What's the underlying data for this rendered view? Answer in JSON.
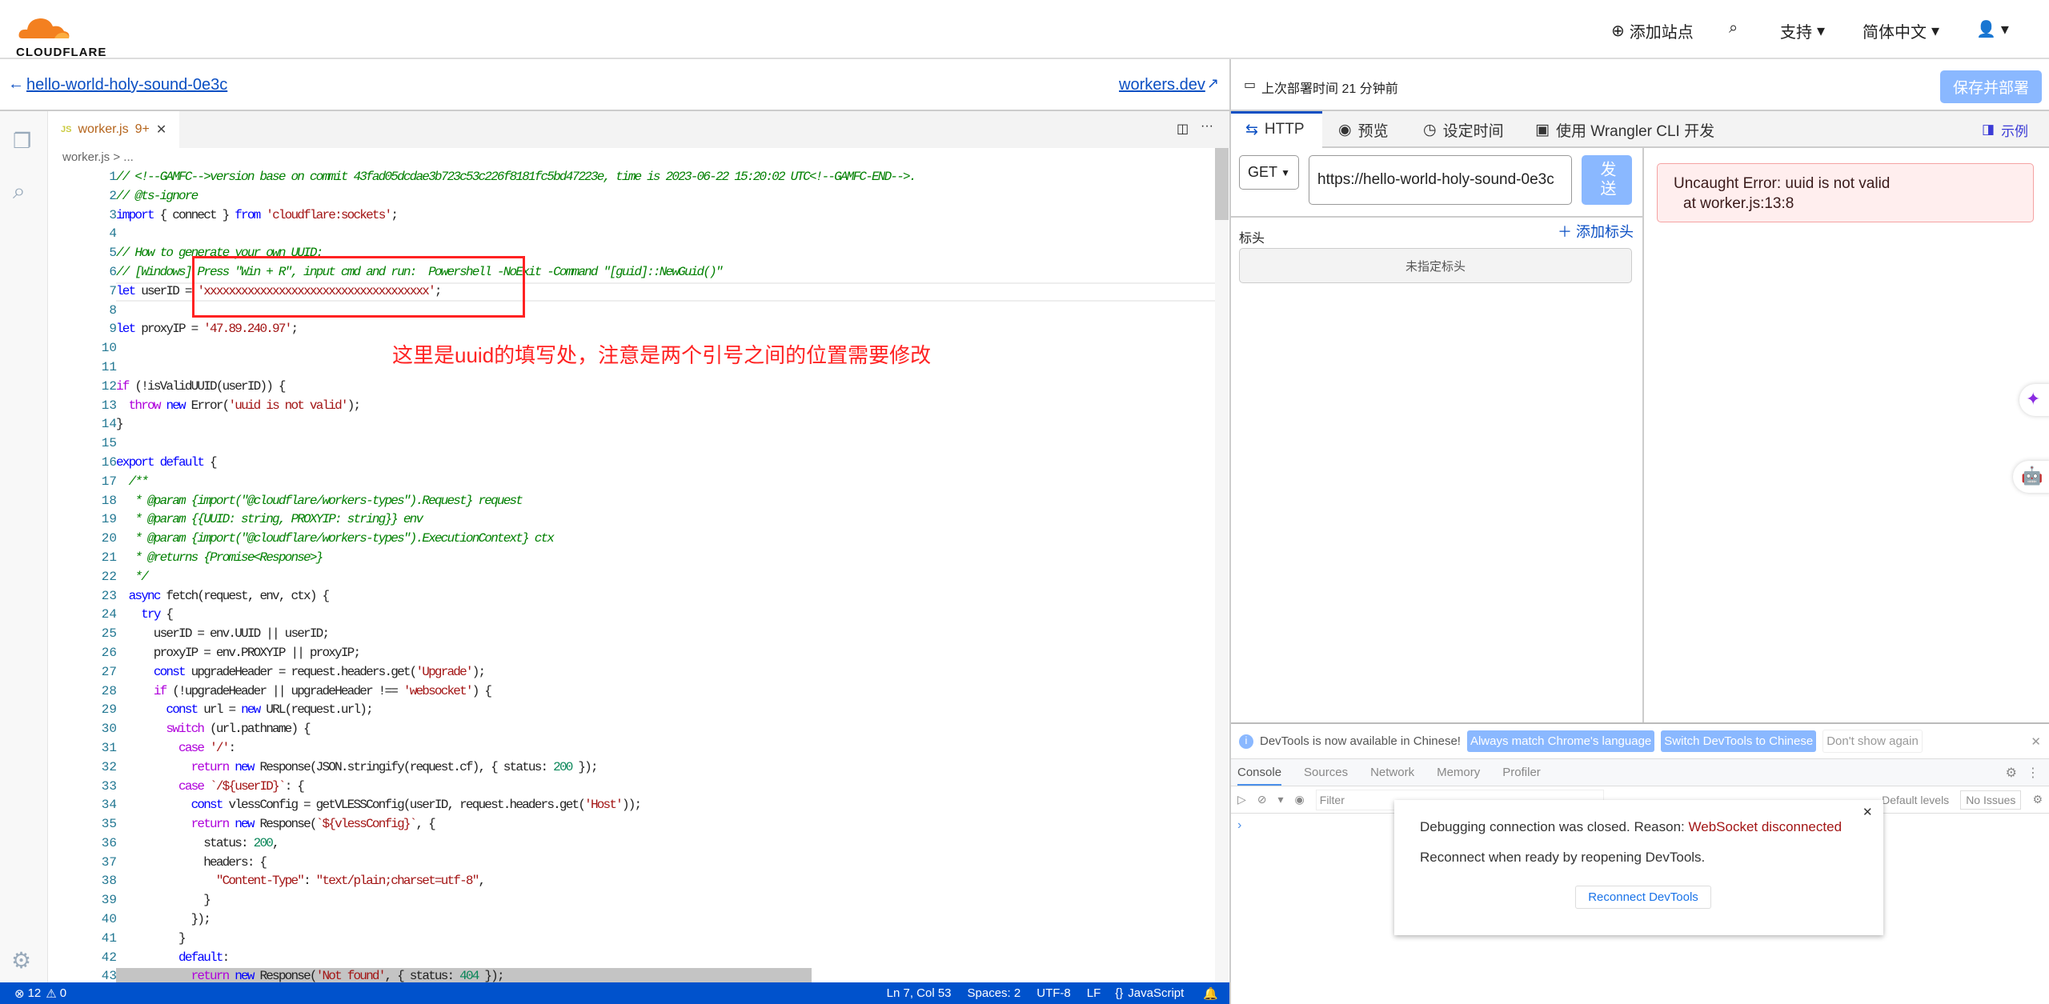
{
  "brand": {
    "name": "CLOUDFLARE",
    "color": "#f38020"
  },
  "header": {
    "add_site": "添加站点",
    "support": "支持",
    "language": "简体中文"
  },
  "subheader": {
    "worker_name": "hello-world-holy-sound-0e3c",
    "workers_dev": "workers.dev",
    "last_deploy": "上次部署时间 21 分钟前",
    "save_deploy": "保存并部署"
  },
  "editor": {
    "tab": {
      "filename": "worker.js",
      "problems": "9+"
    },
    "breadcrumb": "worker.js > ...",
    "annotation": "这里是uuid的填写处，注意是两个引号之间的位置需要修改",
    "lines": [
      "// <!--GAMFC-->version base on commit 43fad05dcdae3b723c53c226f8181fc5bd47223e, time is 2023-06-22 15:20:02 UTC<!--GAMFC-END-->.",
      "// @ts-ignore",
      "import { connect } from 'cloudflare:sockets';",
      "",
      "// How to generate your own UUID:",
      "// [Windows] Press \"Win + R\", input cmd and run:  Powershell -NoExit -Command \"[guid]::NewGuid()\"",
      "let userID = 'xxxxxxxxxxxxxxxxxxxxxxxxxxxxxxxxxxxx';",
      "",
      "let proxyIP = '47.89.240.97';",
      "",
      "",
      "if (!isValidUUID(userID)) {",
      "  throw new Error('uuid is not valid');",
      "}",
      "",
      "export default {",
      "  /**",
      "   * @param {import(\"@cloudflare/workers-types\").Request} request",
      "   * @param {{UUID: string, PROXYIP: string}} env",
      "   * @param {import(\"@cloudflare/workers-types\").ExecutionContext} ctx",
      "   * @returns {Promise<Response>}",
      "   */",
      "  async fetch(request, env, ctx) {",
      "    try {",
      "      userID = env.UUID || userID;",
      "      proxyIP = env.PROXYIP || proxyIP;",
      "      const upgradeHeader = request.headers.get('Upgrade');",
      "      if (!upgradeHeader || upgradeHeader !== 'websocket') {",
      "        const url = new URL(request.url);",
      "        switch (url.pathname) {",
      "          case '/':",
      "            return new Response(JSON.stringify(request.cf), { status: 200 });",
      "          case `/${userID}`: {",
      "            const vlessConfig = getVLESSConfig(userID, request.headers.get('Host'));",
      "            return new Response(`${vlessConfig}`, {",
      "              status: 200,",
      "              headers: {",
      "                \"Content-Type\": \"text/plain;charset=utf-8\",",
      "              }",
      "            });",
      "          }",
      "          default:",
      "            return new Response('Not found', { status: 404 });"
    ]
  },
  "statusbar": {
    "errors": "12",
    "warnings": "0",
    "position": "Ln 7, Col 53",
    "spaces": "Spaces: 2",
    "encoding": "UTF-8",
    "eol": "LF",
    "language": "JavaScript"
  },
  "panel": {
    "tabs": [
      {
        "label": "HTTP",
        "icon": "arrows-icon"
      },
      {
        "label": "预览",
        "icon": "eye-icon"
      },
      {
        "label": "设定时间",
        "icon": "clock-icon"
      },
      {
        "label": "使用 Wrangler CLI 开发",
        "icon": "terminal-icon"
      }
    ],
    "examples": "示例",
    "method": "GET",
    "url": "https://hello-world-holy-sound-0e3c",
    "send": "发送",
    "headers_label": "标头",
    "add_header": "添加标头",
    "no_headers": "未指定标头",
    "error_line1": "Uncaught Error: uuid is not valid",
    "error_line2": "at worker.js:13:8"
  },
  "devtools": {
    "banner": "DevTools is now available in Chinese!",
    "always_match": "Always match Chrome's language",
    "switch_chinese": "Switch DevTools to Chinese",
    "dont_show": "Don't show again",
    "tabs": [
      "Console",
      "Sources",
      "Network",
      "Memory",
      "Profiler"
    ],
    "filter_placeholder": "Filter",
    "levels": "Default levels",
    "no_issues": "No Issues",
    "dialog": {
      "msg": "Debugging connection was closed. Reason: ",
      "reason": "WebSocket disconnected",
      "hint": "Reconnect when ready by reopening DevTools.",
      "button": "Reconnect DevTools"
    }
  }
}
